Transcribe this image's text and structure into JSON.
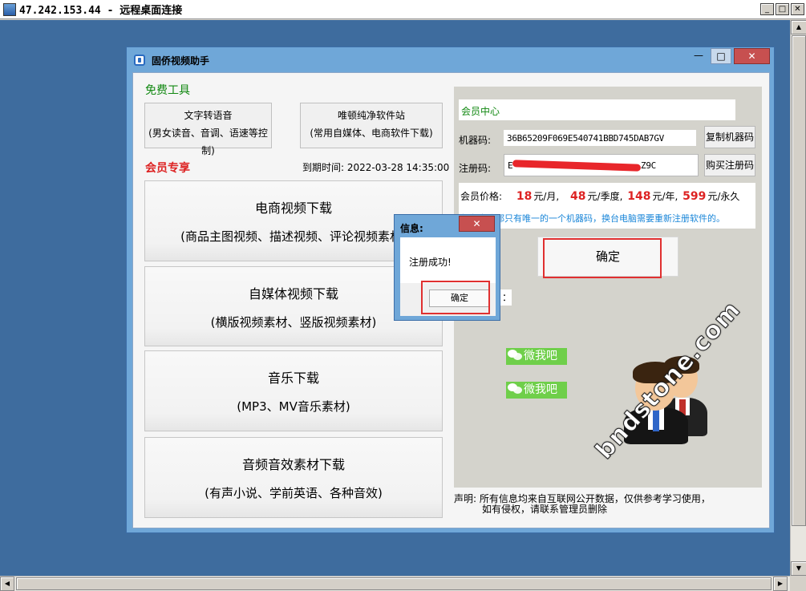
{
  "rdp": {
    "title": "47.242.153.44 - 远程桌面连接",
    "minimize": "_",
    "restore": "□",
    "close": "✕"
  },
  "app": {
    "title": "固侨视频助手",
    "minimize": "—",
    "maximize": "□",
    "close": "✕",
    "free_tools_title": "免费工具",
    "tools": [
      {
        "line1": "文字转语音",
        "line2": "(男女读音、音调、语速等控制)"
      },
      {
        "line1": "唯顿纯净软件站",
        "line2": "(常用自媒体、电商软件下载)"
      }
    ],
    "member_title": "会员专享",
    "expire": "到期时间: 2022-03-28 14:35:00",
    "features": [
      {
        "title": "电商视频下载",
        "desc": "(商品主图视频、描述视频、评论视频素材)"
      },
      {
        "title": "自媒体视频下载",
        "desc": "(横版视频素材、竖版视频素材)"
      },
      {
        "title": "音乐下载",
        "desc": "(MP3、MV音乐素材)"
      },
      {
        "title": "音频音效素材下载",
        "desc": "(有声小说、学前英语、各种音效)"
      }
    ],
    "member_center": {
      "title": "会员中心",
      "machine_label": "机器码:",
      "machine_code": "36B65209F069E540741BBD745DAB7GV",
      "copy_btn": "复制机器码",
      "reg_label": "注册码:",
      "reg_prefix": "E",
      "reg_suffix": "Z9C",
      "buy_btn": "购买注册码",
      "price_label": "会员价格:",
      "prices": [
        {
          "num": "18",
          "unit": "元/月,"
        },
        {
          "num": "48",
          "unit": "元/季度,"
        },
        {
          "num": "148",
          "unit": "元/年,"
        },
        {
          "num": "599",
          "unit": "元/永久"
        }
      ],
      "note": "每台电脑都只有唯一的一个机器码，换台电脑需要重新注册软件的。",
      "confirm": "确定",
      "label_fragment": "："
    },
    "wechat": [
      "微我吧",
      "微我吧"
    ],
    "watermark": "bndstone.com",
    "notice_line1": "声明: 所有信息均来自互联网公开数据，仅供参考学习使用，",
    "notice_line2": "如有侵权，请联系管理员删除"
  },
  "dialog": {
    "title": "信息:",
    "close": "✕",
    "message": "注册成功!",
    "ok": "确定"
  },
  "colors": {
    "desktop": "#3e6c9e",
    "window_frame": "#6fa7d8",
    "close_red": "#c75050",
    "highlight_red": "#e03030",
    "green_text": "#118811",
    "wechat_green": "#6fcf4a",
    "note_blue": "#1a86d8"
  }
}
